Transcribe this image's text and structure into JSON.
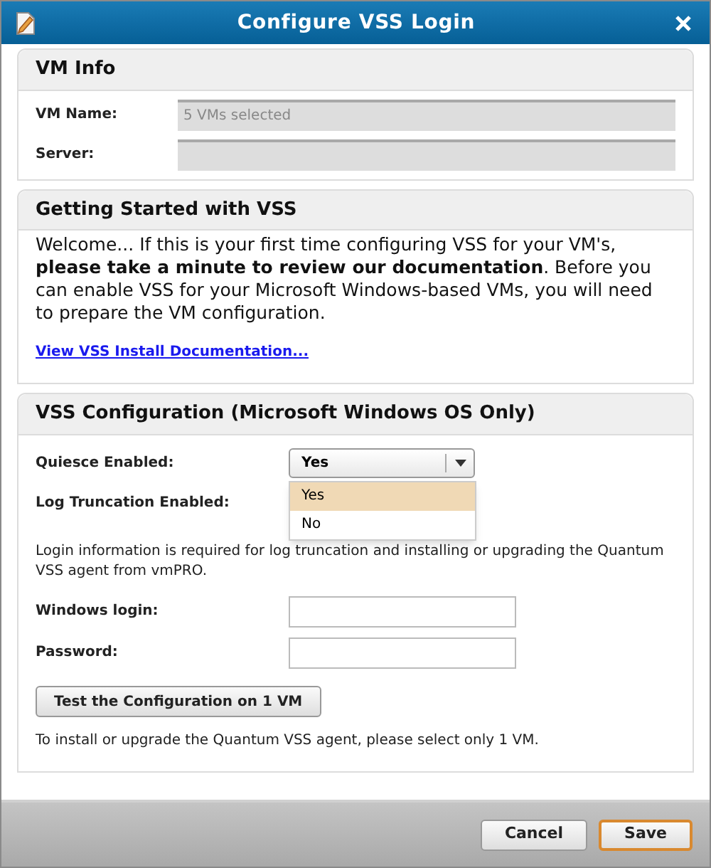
{
  "window": {
    "title": "Configure VSS Login"
  },
  "vm_info": {
    "heading": "VM Info",
    "fields": [
      {
        "label": "VM Name:",
        "placeholder": "5 VMs selected",
        "disabled": true
      },
      {
        "label": "Server:",
        "disabled": true
      }
    ]
  },
  "getting_started": {
    "heading": "Getting Started with VSS",
    "text": "Welcome... If this is your first time configuring VSS for your VM's, **please take a minute to review our documentation**. Before you can enable VSS for your Microsoft Windows-based VMs, you will need to prepare the VM configuration.",
    "link": "View VSS Install Documentation..."
  },
  "vss_config": {
    "heading": "VSS Configuration (Microsoft Windows OS Only)",
    "quiesce": {
      "label": "Quiesce Enabled:",
      "value": "Yes",
      "expanded": true,
      "options": [
        {
          "label": "Yes",
          "selected": true
        },
        {
          "label": "No",
          "selected": false
        }
      ]
    },
    "log_truncation": {
      "label": "Log Truncation Enabled:"
    },
    "note": "Login information is required for log truncation and installing or upgrading the Quantum VSS agent from vmPRO.",
    "login_fields": [
      {
        "label": "Windows login:"
      },
      {
        "label": "Password:"
      }
    ],
    "test_button": "Test the Configuration on 1 VM",
    "footnote": "To install or upgrade the Quantum VSS agent, please select only 1 VM."
  },
  "buttons": [
    {
      "label": "Cancel",
      "kind": "secondary"
    },
    {
      "label": "Save",
      "kind": "primary"
    }
  ]
}
